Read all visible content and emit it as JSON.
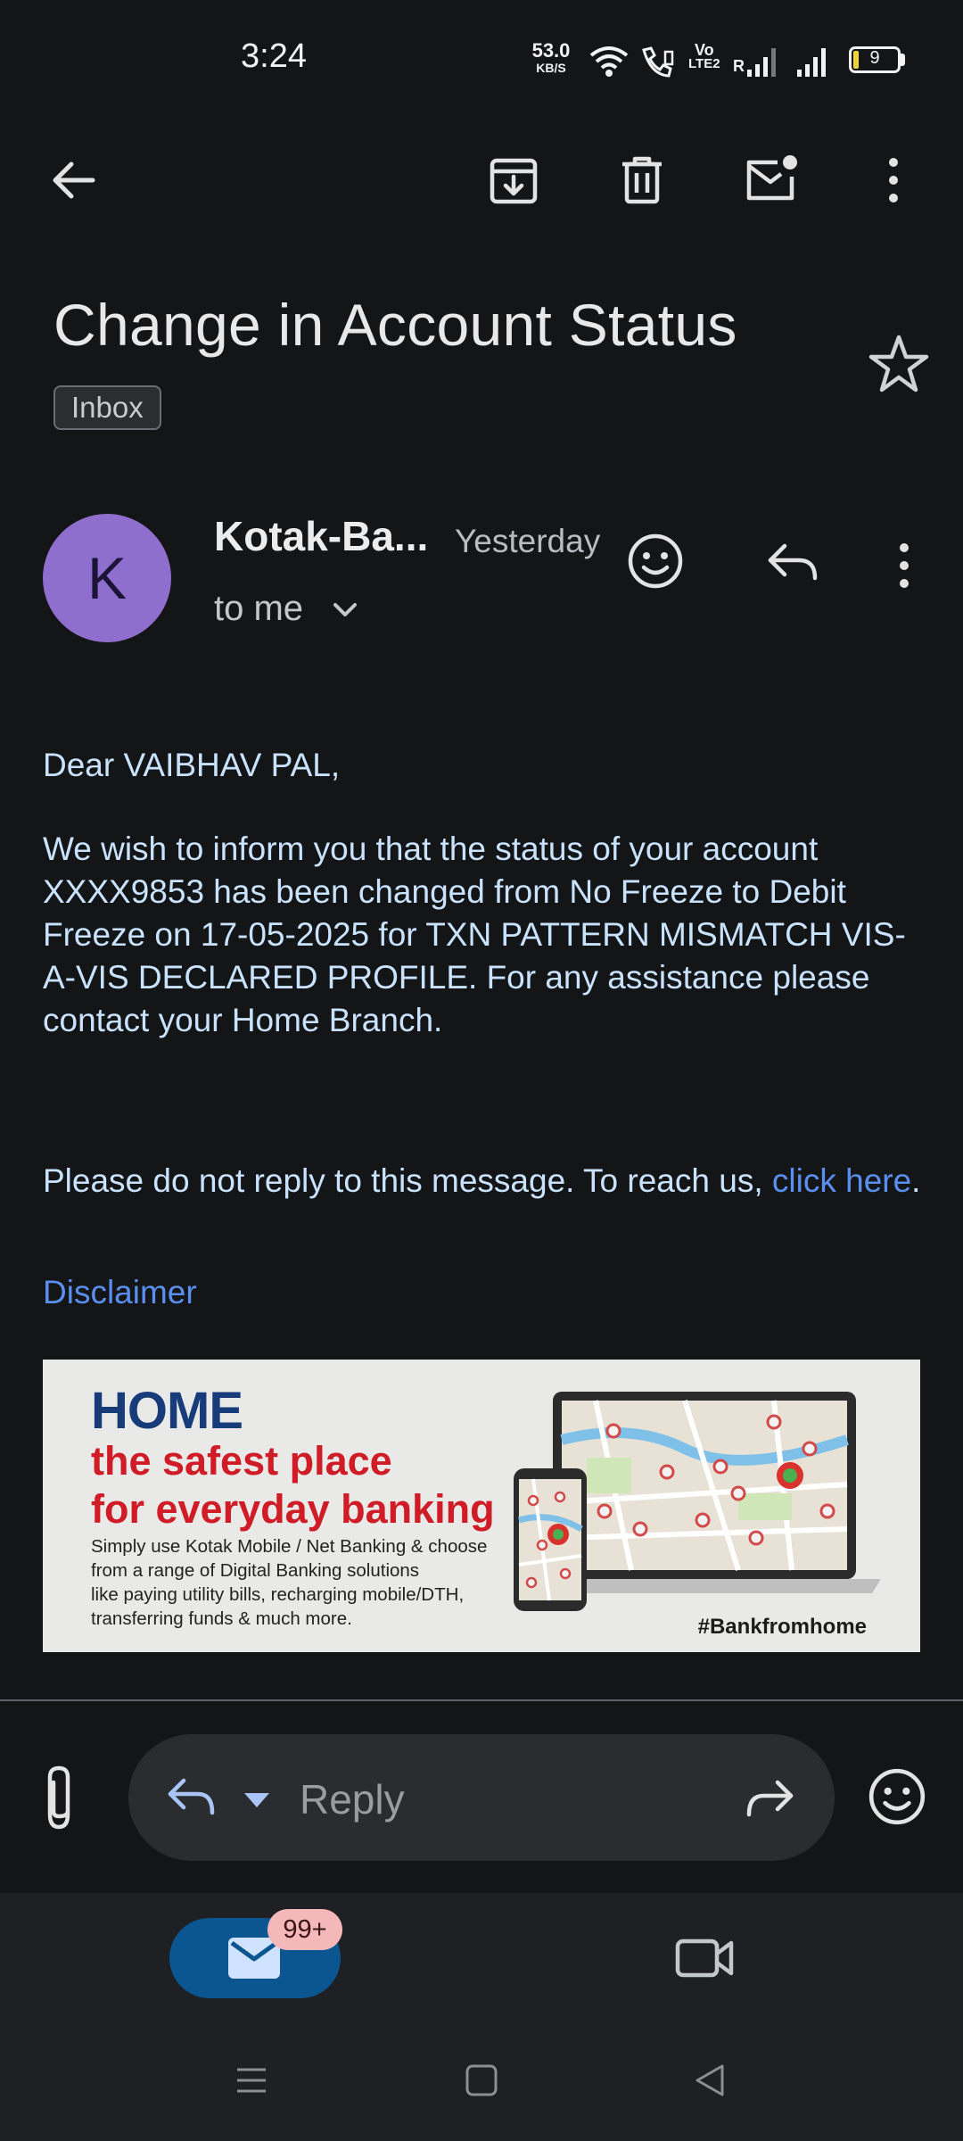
{
  "status_bar": {
    "time": "3:24",
    "net_speed_value": "53.0",
    "net_speed_unit": "KB/S",
    "volte_top": "Vo",
    "volte_bottom": "LTE2",
    "roaming": "R",
    "battery": "9"
  },
  "toolbar": {
    "icons": [
      "back-arrow-icon",
      "archive-icon",
      "delete-icon",
      "mark-unread-icon",
      "more-vert-icon"
    ]
  },
  "email": {
    "subject": "Change in Account Status",
    "label": "Inbox",
    "sender_initial": "K",
    "sender_name": "Kotak-Ba...",
    "time": "Yesterday",
    "recipient": "to me",
    "greeting": "Dear VAIBHAV PAL,",
    "paragraph": "We wish to inform you that the status of your account XXXX9853 has been changed from No Freeze to Debit Freeze on 17-05-2025 for TXN PATTERN MISMATCH VIS-A-VIS DECLARED PROFILE. For any assistance please contact your Home Branch.",
    "noreply_text": "Please do not reply to this message. To reach us, ",
    "noreply_link": "click here",
    "noreply_end": ".",
    "disclaimer": "Disclaimer"
  },
  "banner": {
    "home": "HOME",
    "line1": "the safest place",
    "line2": "for everyday banking",
    "desc1": "Simply use Kotak Mobile / Net Banking & choose",
    "desc2": "from a range of Digital Banking solutions",
    "desc3": "like paying utility bills, recharging mobile/DTH,",
    "desc4": "transferring funds & much more.",
    "hashtag": "#Bankfromhome"
  },
  "reply_bar": {
    "placeholder": "Reply"
  },
  "bottom_nav": {
    "mail_badge": "99+"
  },
  "colors": {
    "background": "#141517",
    "avatar": "#8e6fce",
    "link": "#5a8ff0",
    "mail_pill": "#0b5590",
    "badge": "#f4b8bb"
  }
}
